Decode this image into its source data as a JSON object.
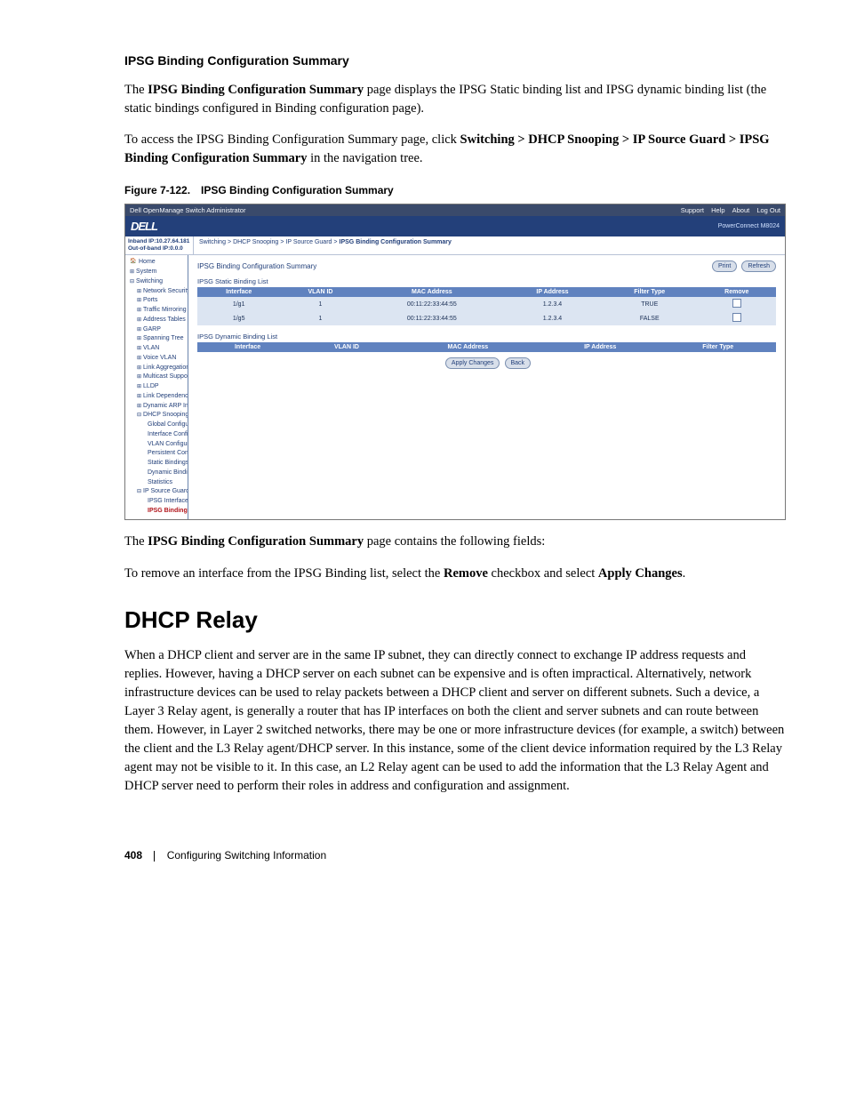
{
  "section": {
    "subtitle": "IPSG Binding Configuration Summary",
    "p1_pre": "The ",
    "p1_bold": "IPSG Binding Configuration Summary",
    "p1_post": " page displays the IPSG Static binding list and IPSG dynamic binding list (the static bindings configured in Binding configuration page).",
    "p2_pre": "To access the IPSG Binding Configuration Summary page, click ",
    "p2_bold": "Switching > DHCP Snooping > IP Source Guard > IPSG Binding Configuration Summary",
    "p2_post": " in the navigation tree.",
    "figcaption_label": "Figure 7-122.",
    "figcaption_title": "IPSG Binding Configuration Summary",
    "p3_pre": "The ",
    "p3_bold": "IPSG Binding Configuration Summary",
    "p3_post": " page contains the following fields:",
    "p4_pre": "To remove an interface from the IPSG Binding list, select the ",
    "p4_bold1": "Remove",
    "p4_mid": " checkbox and select ",
    "p4_bold2": "Apply Changes",
    "p4_post": "."
  },
  "dhcp_relay": {
    "title": "DHCP Relay",
    "paragraph": "When a DHCP client and server are in the same IP subnet, they can directly connect to exchange IP address requests and replies. However, having a DHCP server on each subnet can be expensive and is often impractical. Alternatively, network infrastructure devices can be used to relay packets between a DHCP client and server on different subnets. Such a device, a Layer 3 Relay agent, is generally a router that has IP interfaces on both the client and server subnets and can route between them. However, in Layer 2 switched networks, there may be one or more infrastructure devices (for example, a switch) between the client and the L3 Relay agent/DHCP server. In this instance, some of the client device information required by the L3 Relay agent may not be visible to it. In this case, an L2 Relay agent can be used to add the information that the L3 Relay Agent and DHCP server need to perform their roles in address and configuration and assignment."
  },
  "footer": {
    "page": "408",
    "chapter": "Configuring Switching Information"
  },
  "figure": {
    "titlebar": {
      "app": "Dell OpenManage Switch Administrator",
      "links": [
        "Support",
        "Help",
        "About",
        "Log Out"
      ]
    },
    "brandbar": {
      "logo": "DELL",
      "product": "PowerConnect M8024"
    },
    "info": {
      "ip": "Inband IP:10.27.64.181",
      "oob": "Out-of-band IP:0.0.0"
    },
    "breadcrumb": [
      "Switching",
      "DHCP Snooping",
      "IP Source Guard",
      "IPSG Binding Configuration Summary"
    ],
    "nav": [
      {
        "label": "Home",
        "cls": "home"
      },
      {
        "label": "System",
        "cls": "expandable"
      },
      {
        "label": "Switching",
        "cls": "expanded"
      },
      {
        "label": "Network Security",
        "cls": "expandable indent1"
      },
      {
        "label": "Ports",
        "cls": "expandable indent1"
      },
      {
        "label": "Traffic Mirroring",
        "cls": "expandable indent1"
      },
      {
        "label": "Address Tables",
        "cls": "expandable indent1"
      },
      {
        "label": "GARP",
        "cls": "expandable indent1"
      },
      {
        "label": "Spanning Tree",
        "cls": "expandable indent1"
      },
      {
        "label": "VLAN",
        "cls": "expandable indent1"
      },
      {
        "label": "Voice VLAN",
        "cls": "expandable indent1"
      },
      {
        "label": "Link Aggregation",
        "cls": "expandable indent1"
      },
      {
        "label": "Multicast Support",
        "cls": "expandable indent1"
      },
      {
        "label": "LLDP",
        "cls": "expandable indent1"
      },
      {
        "label": "Link Dependency",
        "cls": "expandable indent1"
      },
      {
        "label": "Dynamic ARP Inspection",
        "cls": "expandable indent1"
      },
      {
        "label": "DHCP Snooping",
        "cls": "expanded indent1"
      },
      {
        "label": "Global Configuration",
        "cls": "indent2"
      },
      {
        "label": "Interface Configuration",
        "cls": "indent2"
      },
      {
        "label": "VLAN Configuration",
        "cls": "indent2"
      },
      {
        "label": "Persistent Configuration",
        "cls": "indent2"
      },
      {
        "label": "Static Bindings Configuration",
        "cls": "indent2"
      },
      {
        "label": "Dynamic Bindings Summary",
        "cls": "indent2"
      },
      {
        "label": "Statistics",
        "cls": "indent2"
      },
      {
        "label": "IP Source Guard",
        "cls": "expanded indent1"
      },
      {
        "label": "IPSG Interface Configuration",
        "cls": "indent2"
      },
      {
        "label": "IPSG Binding Configuration",
        "cls": "indent2 sel"
      }
    ],
    "content": {
      "title": "IPSG Binding Configuration Summary",
      "print_btn": "Print",
      "refresh_btn": "Refresh",
      "static_title": "IPSG Static Binding List",
      "static_headers": [
        "Interface",
        "VLAN ID",
        "MAC Address",
        "IP Address",
        "Filter Type",
        "Remove"
      ],
      "static_rows": [
        {
          "iface": "1/g1",
          "vlan": "1",
          "mac": "00:11:22:33:44:55",
          "ip": "1.2.3.4",
          "filter": "TRUE"
        },
        {
          "iface": "1/g5",
          "vlan": "1",
          "mac": "00:11:22:33:44:55",
          "ip": "1.2.3.4",
          "filter": "FALSE"
        }
      ],
      "dynamic_title": "IPSG Dynamic Binding List",
      "dynamic_headers": [
        "Interface",
        "VLAN ID",
        "MAC Address",
        "IP Address",
        "Filter Type"
      ],
      "apply_btn": "Apply Changes",
      "back_btn": "Back"
    }
  }
}
